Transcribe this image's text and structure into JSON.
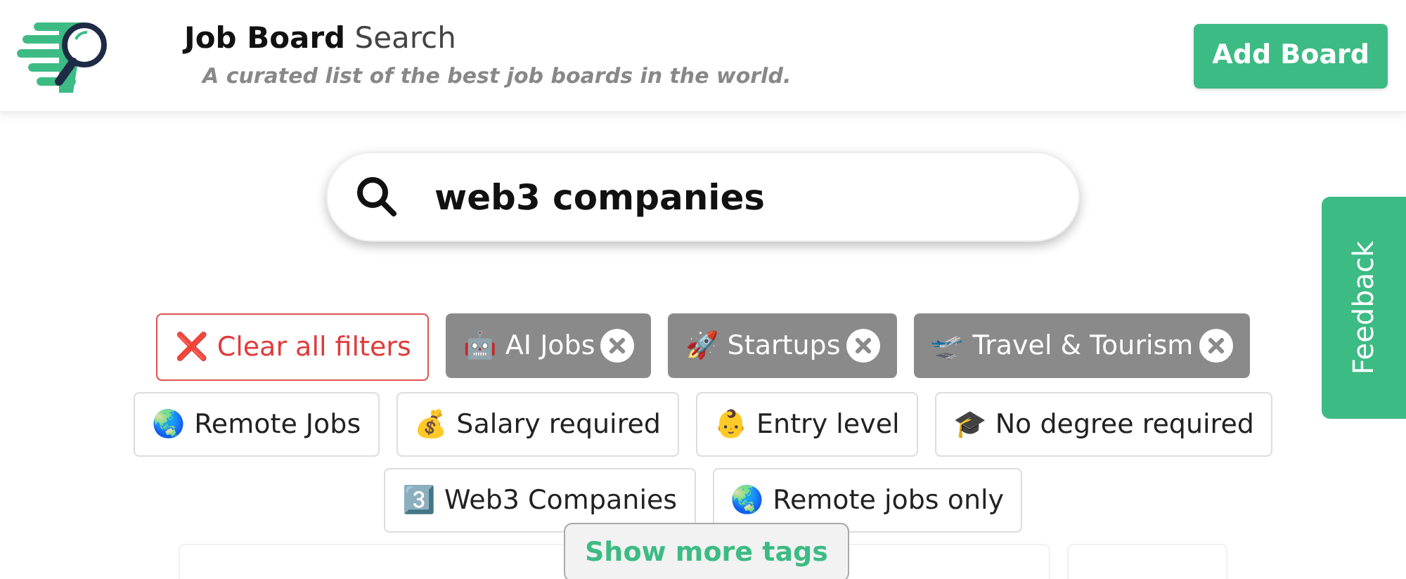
{
  "header": {
    "title_bold": "Job Board",
    "title_rest": "Search",
    "tagline": "A curated list of the best job boards in the world.",
    "add_button": "Add Board"
  },
  "search": {
    "value": "web3 companies"
  },
  "clear_filters": "❌ Clear all filters",
  "tags": [
    {
      "label": "🤖 AI Jobs",
      "selected": true
    },
    {
      "label": "🚀 Startups",
      "selected": true
    },
    {
      "label": "🛫 Travel & Tourism",
      "selected": true
    },
    {
      "label": "🌏 Remote Jobs",
      "selected": false
    },
    {
      "label": "💰 Salary required",
      "selected": false
    },
    {
      "label": "👶 Entry level",
      "selected": false
    },
    {
      "label": "🎓 No degree required",
      "selected": false
    },
    {
      "label": "3️⃣ Web3 Companies",
      "selected": false
    },
    {
      "label": "🌏 Remote jobs only",
      "selected": false
    }
  ],
  "faded_tags": [
    {
      "kind": "wide"
    },
    {
      "kind": "narrow"
    }
  ],
  "show_more": "Show more tags",
  "feedback": "Feedback"
}
